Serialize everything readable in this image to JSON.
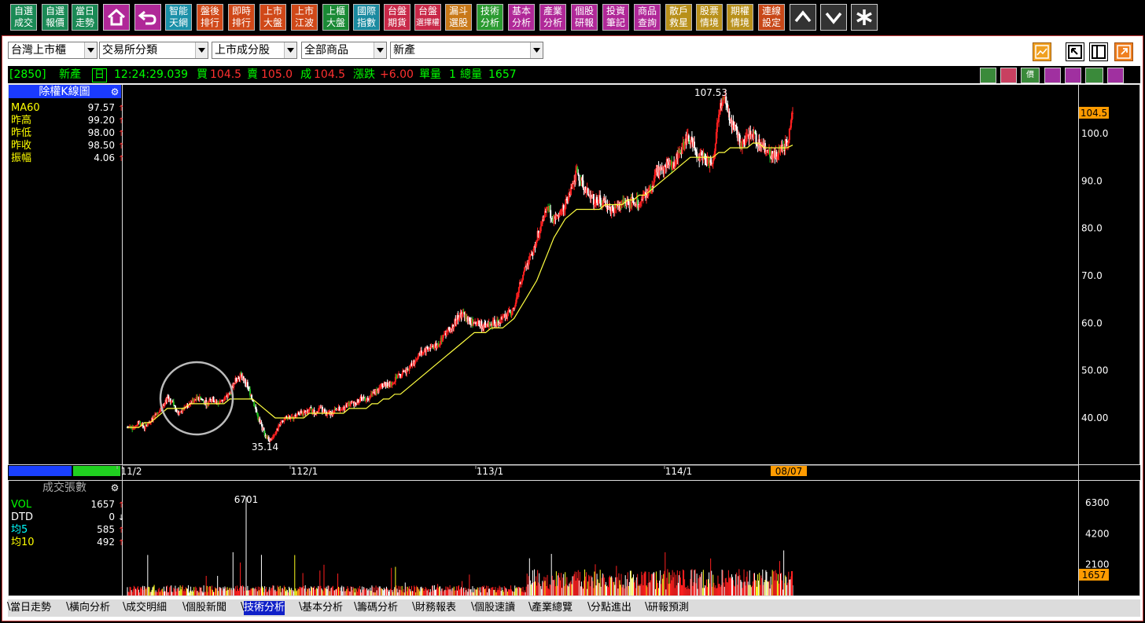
{
  "toolbar": {
    "buttons": [
      {
        "l1": "自選",
        "l2": "成交",
        "color": "#1a8a55"
      },
      {
        "l1": "自選",
        "l2": "報價",
        "color": "#1a8a55"
      },
      {
        "l1": "當日",
        "l2": "走勢",
        "color": "#1a8a55"
      },
      {
        "l1": "智能",
        "l2": "天網",
        "color": "#1a90a8"
      },
      {
        "l1": "盤後",
        "l2": "排行",
        "color": "#d04818"
      },
      {
        "l1": "即時",
        "l2": "排行",
        "color": "#d04818"
      },
      {
        "l1": "上市",
        "l2": "大盤",
        "color": "#d04818"
      },
      {
        "l1": "上市",
        "l2": "江波",
        "color": "#d04818"
      },
      {
        "l1": "上櫃",
        "l2": "大盤",
        "color": "#1a8a35"
      },
      {
        "l1": "國際",
        "l2": "指數",
        "color": "#1a8aa0"
      },
      {
        "l1": "台盤",
        "l2": "期貨",
        "color": "#c82848"
      },
      {
        "l1": "台盤",
        "l2": "選擇權",
        "color": "#c82848"
      },
      {
        "l1": "漏斗",
        "l2": "選股",
        "color": "#c87818"
      },
      {
        "l1": "技術",
        "l2": "分析",
        "color": "#2a9a30"
      },
      {
        "l1": "基本",
        "l2": "分析",
        "color": "#b02898"
      },
      {
        "l1": "產業",
        "l2": "分析",
        "color": "#b02898"
      },
      {
        "l1": "個股",
        "l2": "研報",
        "color": "#b02898"
      },
      {
        "l1": "投資",
        "l2": "筆記",
        "color": "#b02898"
      },
      {
        "l1": "商品",
        "l2": "查詢",
        "color": "#b02898"
      },
      {
        "l1": "散戶",
        "l2": "救星",
        "color": "#b8901a"
      },
      {
        "l1": "股票",
        "l2": "情境",
        "color": "#b8901a"
      },
      {
        "l1": "期權",
        "l2": "情境",
        "color": "#b8901a"
      },
      {
        "l1": "連線",
        "l2": "設定",
        "color": "#c84818"
      }
    ],
    "home_icon": "home-icon",
    "back_icon": "undo-arrow-icon",
    "up_icon": "arrow-up-icon",
    "down_icon": "arrow-down-icon",
    "star_icon": "asterisk-icon"
  },
  "selectors": {
    "market": "台灣上市櫃",
    "category": "交易所分類",
    "group": "上市成分股",
    "products": "全部商品",
    "industry": "新產"
  },
  "quote": {
    "code": "[2850]",
    "name": "新產",
    "period": "日",
    "time": "12:24:29.039",
    "bid_label": "買",
    "bid": "104.5",
    "ask_label": "賣",
    "ask": "105.0",
    "last_label": "成",
    "last": "104.5",
    "change_label": "漲跌",
    "change": "+6.00",
    "unit_vol_label": "單量",
    "unit_vol": "1",
    "total_vol_label": "總量",
    "total_vol": "1657"
  },
  "price_panel": {
    "title": "除權K線圖",
    "rows": [
      {
        "label": "MA60",
        "value": "97.57",
        "color": "#ffff00"
      },
      {
        "label": "昨高",
        "value": "99.20",
        "color": "#ffff00"
      },
      {
        "label": "昨低",
        "value": "98.00",
        "color": "#ffff00"
      },
      {
        "label": "昨收",
        "value": "98.50",
        "color": "#ffff00"
      },
      {
        "label": "振幅",
        "value": "4.06",
        "color": "#ffff00"
      }
    ],
    "axis_ticks": [
      "100.0",
      "90.0",
      "80.0",
      "70.0",
      "60.0",
      "50.00",
      "40.00"
    ],
    "last_price_tag": "104.5",
    "high_label": "107.53",
    "low_label": "35.14",
    "date_labels": [
      "11/2",
      "112/1",
      "113/1",
      "114/1"
    ],
    "current_date": "08/07"
  },
  "volume_panel": {
    "title": "成交張數",
    "rows": [
      {
        "label": "VOL",
        "value": "1657",
        "color": "#00ff00"
      },
      {
        "label": "DTD",
        "value": "0",
        "color": "#ffffff"
      },
      {
        "label": "均5",
        "value": "585",
        "color": "#00ffff"
      },
      {
        "label": "均10",
        "value": "492",
        "color": "#ffff00"
      }
    ],
    "axis_ticks": [
      "6300",
      "4200",
      "2100"
    ],
    "max_label": "6701",
    "last_vol_tag": "1657"
  },
  "chart_data": {
    "type": "candlestick",
    "x_labels": [
      "11/2",
      "112/1",
      "113/1",
      "114/1",
      "08/07"
    ],
    "price_axis_range": [
      30,
      110
    ],
    "price_high": 107.53,
    "price_low": 35.14,
    "last_close": 104.5,
    "ma60_last": 97.57,
    "close_path": [
      38,
      38,
      39,
      38,
      39,
      41,
      42,
      44,
      43,
      41,
      42,
      43,
      44,
      44,
      43,
      44,
      43,
      44,
      45,
      48,
      49,
      47,
      44,
      40,
      37,
      35.14,
      37,
      39,
      40,
      40,
      41,
      41,
      42,
      41,
      42,
      41,
      41,
      42,
      42,
      43,
      43,
      44,
      44,
      45,
      46,
      47,
      47,
      48,
      49,
      50,
      51,
      53,
      54,
      55,
      55,
      56,
      58,
      59,
      61,
      62,
      61,
      60,
      60,
      59,
      60,
      60,
      61,
      62,
      63,
      68,
      72,
      74,
      78,
      82,
      84,
      82,
      83,
      85,
      88,
      92,
      90,
      87,
      86,
      86,
      85,
      84,
      84,
      86,
      85,
      86,
      85,
      87,
      88,
      92,
      92,
      94,
      93,
      96,
      98,
      99,
      96,
      95,
      94,
      94,
      105,
      107.53,
      103,
      101,
      97,
      99,
      100,
      98,
      97,
      96,
      95,
      97,
      98,
      104.5
    ],
    "ma60_path": [
      38,
      38,
      38,
      39,
      39,
      40,
      41,
      42,
      42,
      42,
      42,
      43,
      43,
      43,
      43,
      43,
      43,
      43,
      44,
      44,
      44,
      44,
      44,
      43,
      42,
      41,
      40,
      40,
      40,
      40,
      40,
      40,
      41,
      41,
      41,
      41,
      41,
      41,
      41,
      42,
      42,
      42,
      42,
      43,
      43,
      44,
      44,
      45,
      45,
      46,
      47,
      48,
      49,
      50,
      51,
      52,
      53,
      54,
      55,
      56,
      57,
      58,
      58,
      58,
      59,
      59,
      59,
      60,
      61,
      63,
      65,
      67,
      69,
      72,
      75,
      78,
      80,
      82,
      83,
      84,
      84,
      84,
      84,
      84,
      85,
      85,
      85,
      85,
      86,
      86,
      87,
      87,
      88,
      89,
      90,
      91,
      92,
      93,
      94,
      95,
      95,
      95,
      95,
      95,
      96,
      96,
      97,
      97,
      97,
      97,
      98,
      98,
      97,
      97,
      97,
      97,
      97,
      97.57
    ],
    "volume_axis_range": [
      0,
      7000
    ],
    "volume_max": 6701,
    "volume_last": 1657
  },
  "tabs": [
    "當日走勢",
    "橫向分析",
    "成交明細",
    "個股新聞",
    "技術分析",
    "基本分析",
    "籌碼分析",
    "財務報表",
    "個股速讀",
    "產業總覽",
    "分點進出",
    "研報預測"
  ],
  "active_tab": "技術分析"
}
